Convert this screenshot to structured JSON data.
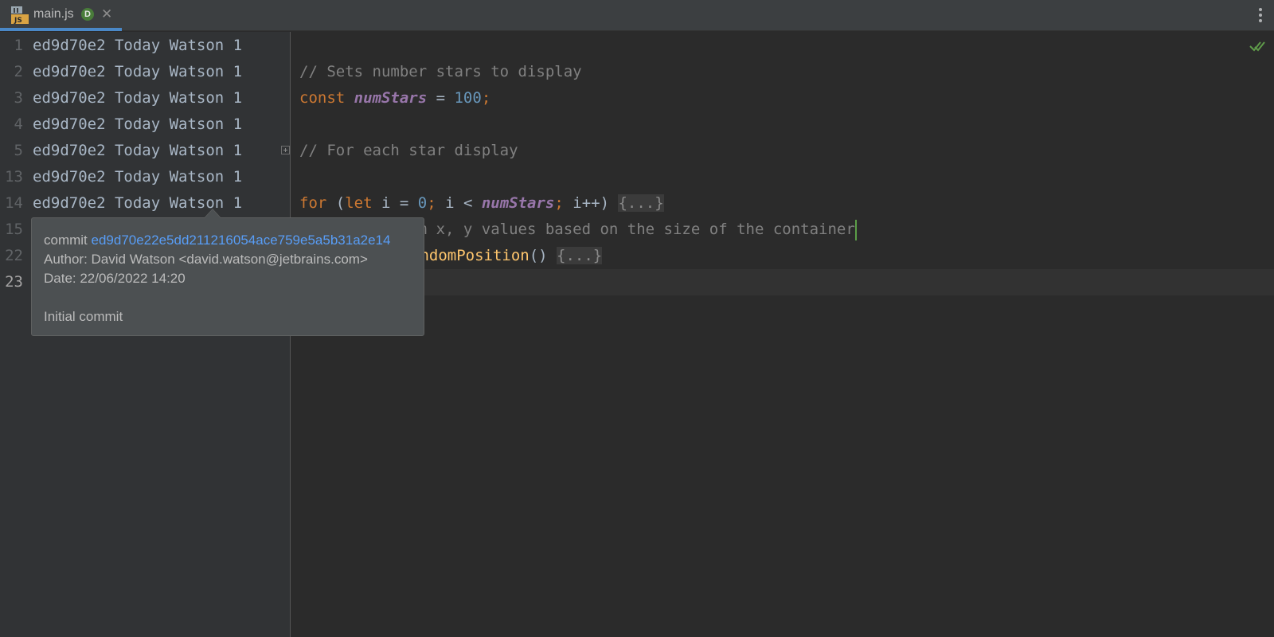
{
  "tab": {
    "filename": "main.js",
    "badge": "D",
    "close": "✕",
    "icon_label": "JS"
  },
  "gutter": {
    "rows": [
      {
        "line": "1",
        "annotation": "ed9d70e2 Today Watson 1"
      },
      {
        "line": "2",
        "annotation": "ed9d70e2 Today Watson 1"
      },
      {
        "line": "3",
        "annotation": "ed9d70e2 Today Watson 1"
      },
      {
        "line": "4",
        "annotation": "ed9d70e2 Today Watson 1"
      },
      {
        "line": "5",
        "annotation": "ed9d70e2 Today Watson 1"
      },
      {
        "line": "13",
        "annotation": "ed9d70e2 Today Watson 1"
      },
      {
        "line": "14",
        "annotation": "ed9d70e2 Today Watson 1"
      },
      {
        "line": "15",
        "annotation": ""
      },
      {
        "line": "22",
        "annotation": ""
      },
      {
        "line": "23",
        "annotation": ""
      }
    ]
  },
  "code": {
    "l1": "// Sets number stars to display",
    "l2_kw": "const ",
    "l2_var": "numStars",
    "l2_eq": " = ",
    "l2_num": "100",
    "l2_semi": ";",
    "l4": "// For each star display",
    "l5_kw": "for",
    "l5_p1": " (",
    "l5_let": "let",
    "l5_p2": " i = ",
    "l5_zero": "0",
    "l5_semi1": ";",
    "l5_p3": " i < ",
    "l5_var": "numStars",
    "l5_semi2": ";",
    "l5_p4": " i++) ",
    "l5_fold": "{...}",
    "l13": "// Gets random x, y values based on the size of the container",
    "l14_fn": "andomPosition",
    "l14_p": "() ",
    "l14_fold": "{...}"
  },
  "popup": {
    "commit_label": "commit ",
    "commit_hash": "ed9d70e22e5dd211216054ace759e5a5b31a2e14",
    "author": "Author: David Watson <david.watson@jetbrains.com>",
    "date": "Date: 22/06/2022 14:20",
    "message": "Initial commit"
  },
  "icons": {
    "inspection": "checkmark-icon",
    "menu": "more-vertical-icon",
    "fold": "fold-expand-icon"
  },
  "colors": {
    "comment": "#808080",
    "keyword": "#cc7832",
    "variable": "#9876aa",
    "number": "#6897bb",
    "function": "#ffc66d",
    "link": "#589df6",
    "accent": "#4a88c7"
  }
}
